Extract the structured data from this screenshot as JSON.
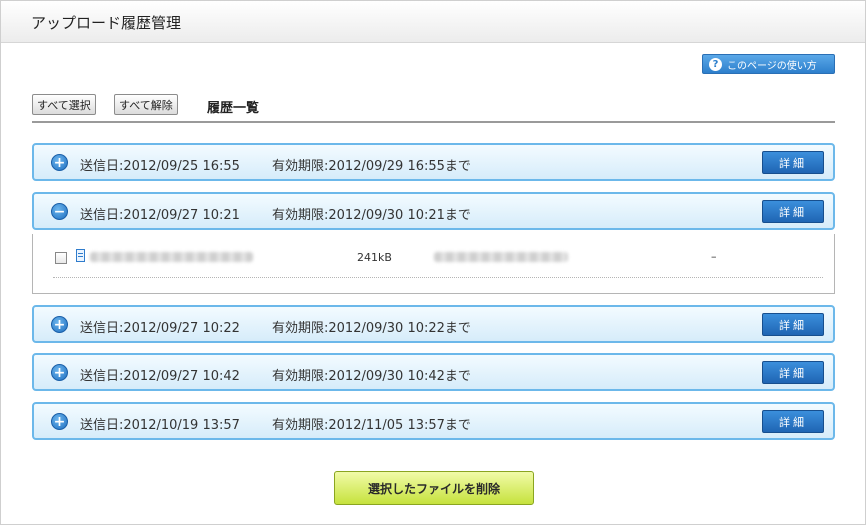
{
  "page": {
    "title": "アップロード履歴管理"
  },
  "help_button": {
    "label": "このページの使い方",
    "icon": "question-icon",
    "icon_glyph": "?"
  },
  "toolbar": {
    "select_all_label": "すべて選択",
    "deselect_all_label": "すべて解除",
    "list_heading": "履歴一覧"
  },
  "history": [
    {
      "sent": "送信日:2012/09/25 16:55",
      "expiry": "有効期限:2012/09/29 16:55まで",
      "expanded": false,
      "toggle_glyph": "+",
      "detail_label": "詳細"
    },
    {
      "sent": "送信日:2012/09/27 10:21",
      "expiry": "有効期限:2012/09/30 10:21まで",
      "expanded": true,
      "toggle_glyph": "−",
      "detail_label": "詳細",
      "files": [
        {
          "size": "241kB",
          "status": "–"
        }
      ]
    },
    {
      "sent": "送信日:2012/09/27 10:22",
      "expiry": "有効期限:2012/09/30 10:22まで",
      "expanded": false,
      "toggle_glyph": "+",
      "detail_label": "詳細"
    },
    {
      "sent": "送信日:2012/09/27 10:42",
      "expiry": "有効期限:2012/09/30 10:42まで",
      "expanded": false,
      "toggle_glyph": "+",
      "detail_label": "詳細"
    },
    {
      "sent": "送信日:2012/10/19 13:57",
      "expiry": "有効期限:2012/11/05 13:57まで",
      "expanded": false,
      "toggle_glyph": "+",
      "detail_label": "詳細"
    }
  ],
  "delete_button": {
    "label": "選択したファイルを削除"
  },
  "colors": {
    "row_border": "#6cb8ea",
    "detail_button": "#1f65b3",
    "delete_button": "#c6e23d",
    "help_button": "#2d7fcc"
  }
}
